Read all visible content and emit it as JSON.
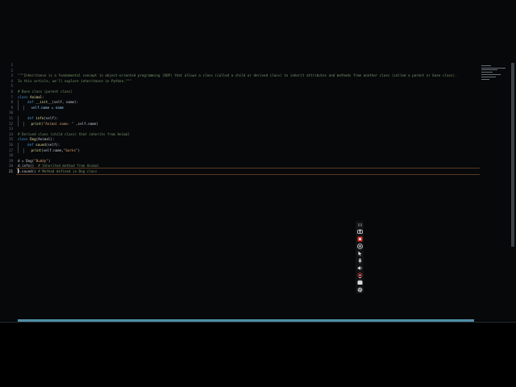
{
  "editor": {
    "line_numbers": [
      "1",
      "2",
      "3",
      "4",
      "5",
      "6",
      "7",
      "8",
      "9",
      "10",
      "11",
      "12",
      "13",
      "14",
      "15",
      "16",
      "17",
      "18",
      "19",
      "20",
      "21"
    ],
    "current_line": "21",
    "docstring_line1": "\"\"\"Inheritance is a fundamental concept in object-oriented programming (OOP) that allows a class (called a child or derived class) to inherit attributes and methods from another class (called a parent or base class).",
    "docstring_line2": "In this article, we'll explore inheritance in Python.\"\"\"",
    "comment_base": "# Base class (parent class)",
    "class_animal": "Animal",
    "kw_class": "class",
    "kw_def": "def",
    "init_name": "__init__",
    "init_args": "(self, name):",
    "self_name_assign": "self.name = name",
    "info_name": "info",
    "info_args": "(self):",
    "print_fn": "print",
    "info_print_str": "\"Animal name: \"",
    "info_print_rest": " ,self.name)",
    "comment_derived": "# Derived class (child class) that inherits from Animal",
    "class_dog": "Dog",
    "class_dog_args": "(Animal):",
    "sound_name": "sound",
    "sound_args": "(self):",
    "sound_print_args": "(self.name,",
    "sound_print_str": "\"barks\"",
    "sound_print_end": ")",
    "d_assign": "d = Dog(",
    "d_assign_str": "\"Buddy\"",
    "d_assign_end": ")",
    "d_info": "d.info()",
    "d_info_comment": "# Inherited method from Animal",
    "d_sound": "d.sound()",
    "d_sound_comment": "# Method defined in Dog class"
  },
  "toolbar": {
    "icons": [
      "drag-handle-icon",
      "camera-icon",
      "record-icon",
      "pause-icon",
      "pointer-icon",
      "microphone-icon",
      "speaker-icon",
      "webcam-icon",
      "annotate-icon",
      "settings-icon"
    ]
  },
  "colors": {
    "background": "#06080a",
    "keyword": "#4f9bd6",
    "string": "#d79c6a",
    "comment": "#7a9468",
    "function": "#e6df9c",
    "record": "#e0302a",
    "scrollbar": "#4f8fa8"
  }
}
